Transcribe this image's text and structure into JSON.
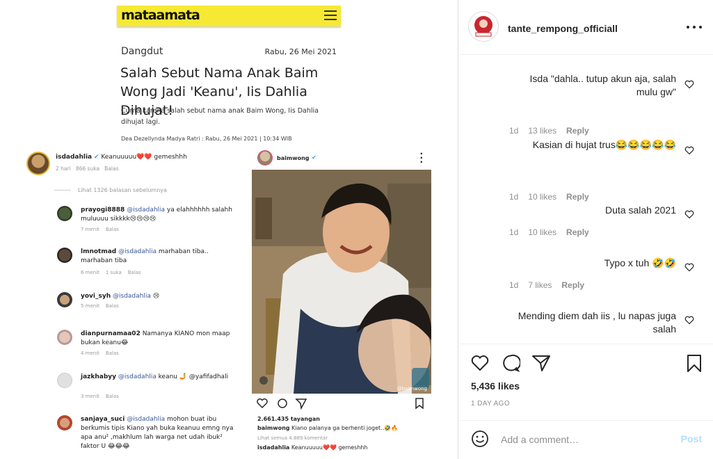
{
  "article": {
    "logo": "mataamata",
    "category": "Dangdut",
    "date": "Rabu, 26 Mei 2021",
    "title": "Salah Sebut Nama Anak Baim Wong Jadi 'Keanu', Iis Dahlia Dihujat!",
    "lead": "Cuma karena salah sebut nama anak Baim Wong, Iis Dahlia dihujat lagi.",
    "byline": "Dea Dezellynda Madya Ratri : Rabu, 26 Mei 2021 | 10:34 WIB"
  },
  "ig_left": {
    "post": {
      "user": "isdadahlia",
      "caption": "Keanuuuuu❤️❤️ gemeshhh",
      "meta_time": "2 hari",
      "meta_likes": "866 suka",
      "meta_reply": "Balas"
    },
    "view_more": "Lihat 1326 balasan sebelumnya",
    "comments": [
      {
        "user": "prayogi8888",
        "mention": "@isdadahlia",
        "text": " ya elahhhhhh salahh muluuuu sikkkk😢😢😢😢",
        "time": "7 menit",
        "likes": "",
        "reply": "Balas"
      },
      {
        "user": "lmnotmad",
        "mention": "@isdadahlia",
        "text": " marhaban tiba.. marhaban tiba",
        "time": "6 menit",
        "likes": "1 suka",
        "reply": "Balas"
      },
      {
        "user": "yovi_syh",
        "mention": "@isdadahlia",
        "text": " 😢",
        "time": "5 menit",
        "likes": "",
        "reply": "Balas"
      },
      {
        "user": "dianpurnamaa02",
        "mention": "",
        "text": " Namanya KIANO mon maap bukan keanu😂",
        "time": "4 menit",
        "likes": "",
        "reply": "Balas"
      },
      {
        "user": "jazkhabyy",
        "mention": "@isdadahlia",
        "text": " keanu 🤳 @yafifadhali",
        "time": "3 menit",
        "likes": "",
        "reply": "Balas"
      },
      {
        "user": "sanjaya_suci",
        "mention": "@isdadahlia",
        "text": " mohon buat ibu berkumis tipis Kiano yah buka keanuu emng nya apa anu² ,makhlum lah warga net udah ibuk² faktor U 😂😂😂",
        "time": "",
        "likes": "",
        "reply": ""
      }
    ]
  },
  "ig_right": {
    "user": "baimwong",
    "views": "2.661.435 tayangan",
    "caption_user": "baimwong",
    "caption": " Kiano palanya ga berhenti joget..🤣🔥",
    "view_all": "Lihat semua 4.889 komentar",
    "last_user": "isdadahlia",
    "last_text": " Keanuuuuu❤️❤️ gemeshhh",
    "watermark": "@baimwong"
  },
  "sidebar": {
    "username": "tante_rempong_officiall",
    "comments": [
      {
        "text": "Isda \"dahla.. tutup akun aja, salah mulu gw\"",
        "time": "1d",
        "likes": "13 likes",
        "reply": "Reply"
      },
      {
        "text": "Kasian di hujat trus😂😂😂😂😂",
        "time": "1d",
        "likes": "10 likes",
        "reply": "Reply"
      },
      {
        "text": "Duta salah 2021",
        "time": "1d",
        "likes": "10 likes",
        "reply": "Reply"
      },
      {
        "text": "Typo x tuh 🤣🤣",
        "time": "1d",
        "likes": "7 likes",
        "reply": "Reply"
      },
      {
        "text": "Mending diem dah iis , lu napas juga salah",
        "time": "",
        "likes": "",
        "reply": ""
      }
    ],
    "likes": "5,436 likes",
    "ago": "1 DAY AGO",
    "add_comment_placeholder": "Add a comment…",
    "post_label": "Post"
  },
  "colors": {
    "accent": "#0095f6",
    "post_disabled": "#b2dffc",
    "muted": "#8e8e8e",
    "brand_yellow": "#f6e933"
  }
}
